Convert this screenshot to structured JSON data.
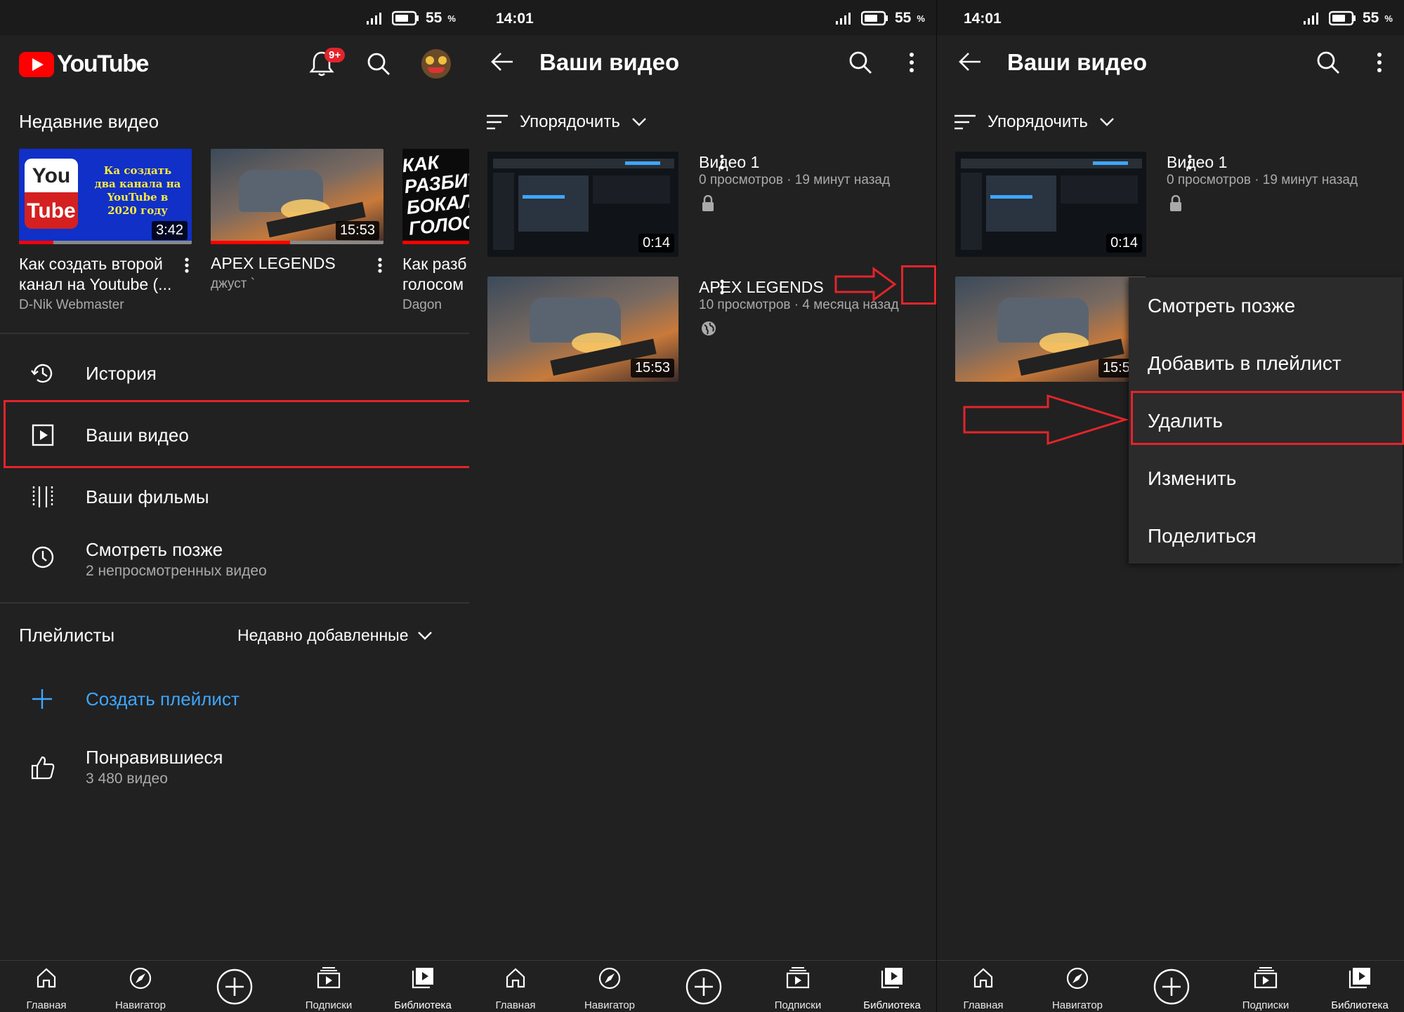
{
  "colors": {
    "background": "#212121",
    "accent_red": "#ff0000",
    "link_blue": "#3ea6ff",
    "annotation_red": "#e3242b"
  },
  "status": {
    "time": "14:01",
    "battery": "55",
    "percent_sign": "%"
  },
  "panel1": {
    "brand": "YouTube",
    "notifications_badge": "9+",
    "recent_title": "Недавние видео",
    "recent_videos": [
      {
        "title_line1": "Как создать второй",
        "title_line2": "канал на Youtube (...",
        "channel": "D-Nik Webmaster",
        "duration": "3:42",
        "thumb_logo_top": "You",
        "thumb_logo_bottom": "Tube",
        "thumb_text": "Ка создать два канала на YouTube в 2020 году"
      },
      {
        "title_line1": "APEX LEGENDS",
        "channel": "джуст `",
        "duration": "15:53"
      },
      {
        "title_line1": "Как разб",
        "title_line2": "голосом",
        "channel": "Dagon",
        "thumb_text": "КАК РАЗБИТЬ БОКАЛ ГОЛОСОМ"
      }
    ],
    "menu": [
      {
        "label": "История",
        "icon": "history-icon"
      },
      {
        "label": "Ваши видео",
        "icon": "play-square-icon"
      },
      {
        "label": "Ваши фильмы",
        "icon": "film-icon"
      },
      {
        "label": "Смотреть позже",
        "sub": "2 непросмотренных видео",
        "icon": "clock-icon"
      }
    ],
    "playlists_title": "Плейлисты",
    "playlists_sort": "Недавно добавленные",
    "create_playlist": "Создать плейлист",
    "liked_title": "Понравившиеся",
    "liked_sub": "3 480 видео"
  },
  "your_videos": {
    "title": "Ваши видео",
    "sort_label": "Упорядочить",
    "videos": [
      {
        "title": "Видео 1",
        "meta": "0 просмотров · 19 минут назад",
        "duration": "0:14",
        "privacy_icon": "lock-icon"
      },
      {
        "title": "APEX LEGENDS",
        "meta": "10 просмотров · 4 месяца назад",
        "duration": "15:53",
        "privacy_icon": "globe-icon"
      }
    ]
  },
  "context_menu": [
    "Смотреть позже",
    "Добавить в плейлист",
    "Удалить",
    "Изменить",
    "Поделиться"
  ],
  "nav": [
    "Главная",
    "Навигатор",
    "",
    "Подписки",
    "Библиотека"
  ]
}
